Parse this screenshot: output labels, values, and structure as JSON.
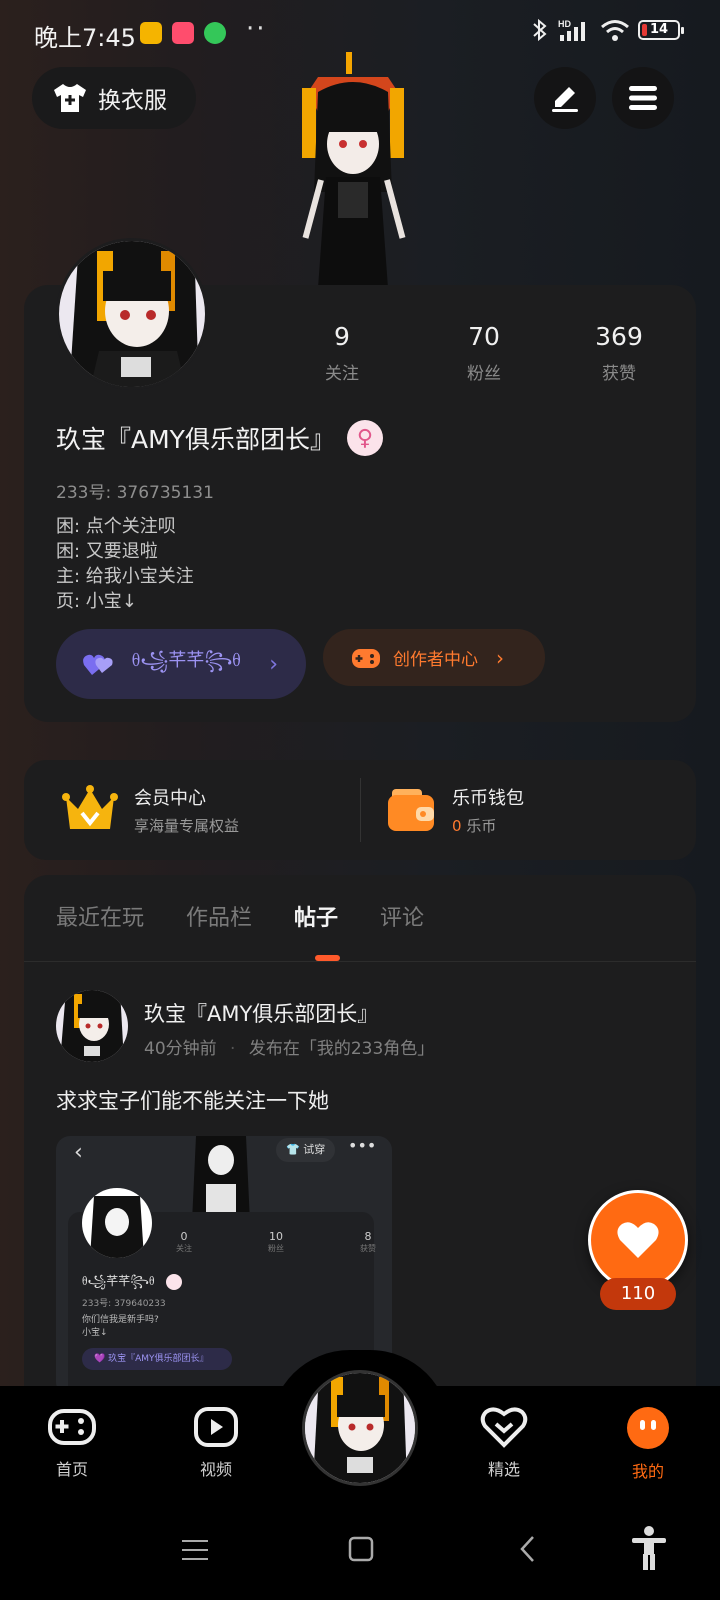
{
  "status_bar": {
    "time": "晚上7:45",
    "battery": "14",
    "signal_label": "HD"
  },
  "header": {
    "outfit_label": "换衣服",
    "edit_icon": "pen-icon",
    "menu_icon": "menu-icon"
  },
  "profile": {
    "stats": [
      {
        "value": "9",
        "label": "关注"
      },
      {
        "value": "70",
        "label": "粉丝"
      },
      {
        "value": "369",
        "label": "获赞"
      }
    ],
    "name": "玖宝『AMY俱乐部团长』",
    "gender_symbol": "♀",
    "id_line": "233号: 376735131",
    "bio_lines": [
      "困: 点个关注呗",
      "困: 又要退啦",
      "主: 给我小宝关注",
      "页: 小宝↓"
    ],
    "club_label": "ᦲ꧁芊芊꧂ᦲ",
    "creator_label": "创作者中心"
  },
  "vip": {
    "member_title": "会员中心",
    "member_sub": "享海量专属权益",
    "wallet_title": "乐币钱包",
    "wallet_amount": "0",
    "wallet_unit": "乐币"
  },
  "tabs": [
    "最近在玩",
    "作品栏",
    "帖子",
    "评论"
  ],
  "active_tab": "帖子",
  "post": {
    "author": "玖宝『AMY俱乐部团长』",
    "time": "40分钟前",
    "published_in": "发布在「我的233角色」",
    "text": "求求宝子们能不能关注一下她",
    "embedded": {
      "try_label": "试穿",
      "stats": [
        {
          "value": "0",
          "label": "关注"
        },
        {
          "value": "10",
          "label": "粉丝"
        },
        {
          "value": "8",
          "label": "获赞"
        }
      ],
      "name": "ᦲ꧁芊芊꧂ᦲ",
      "id_line": "233号: 379640233",
      "bio1": "你们信我是新手吗?",
      "bio2": "小宝↓",
      "chip": "玖宝『AMY俱乐部团长』"
    }
  },
  "like_count": "110",
  "bottom_nav": [
    {
      "label": "首页",
      "icon": "gamepad-icon"
    },
    {
      "label": "视频",
      "icon": "play-icon"
    },
    {
      "label": "精选",
      "icon": "heart-badge-icon"
    },
    {
      "label": "我的",
      "icon": "face-icon"
    }
  ],
  "colors": {
    "accent": "#ff6a12",
    "club_purple": "#9c93f2",
    "card_bg": "#1d1d1e"
  }
}
